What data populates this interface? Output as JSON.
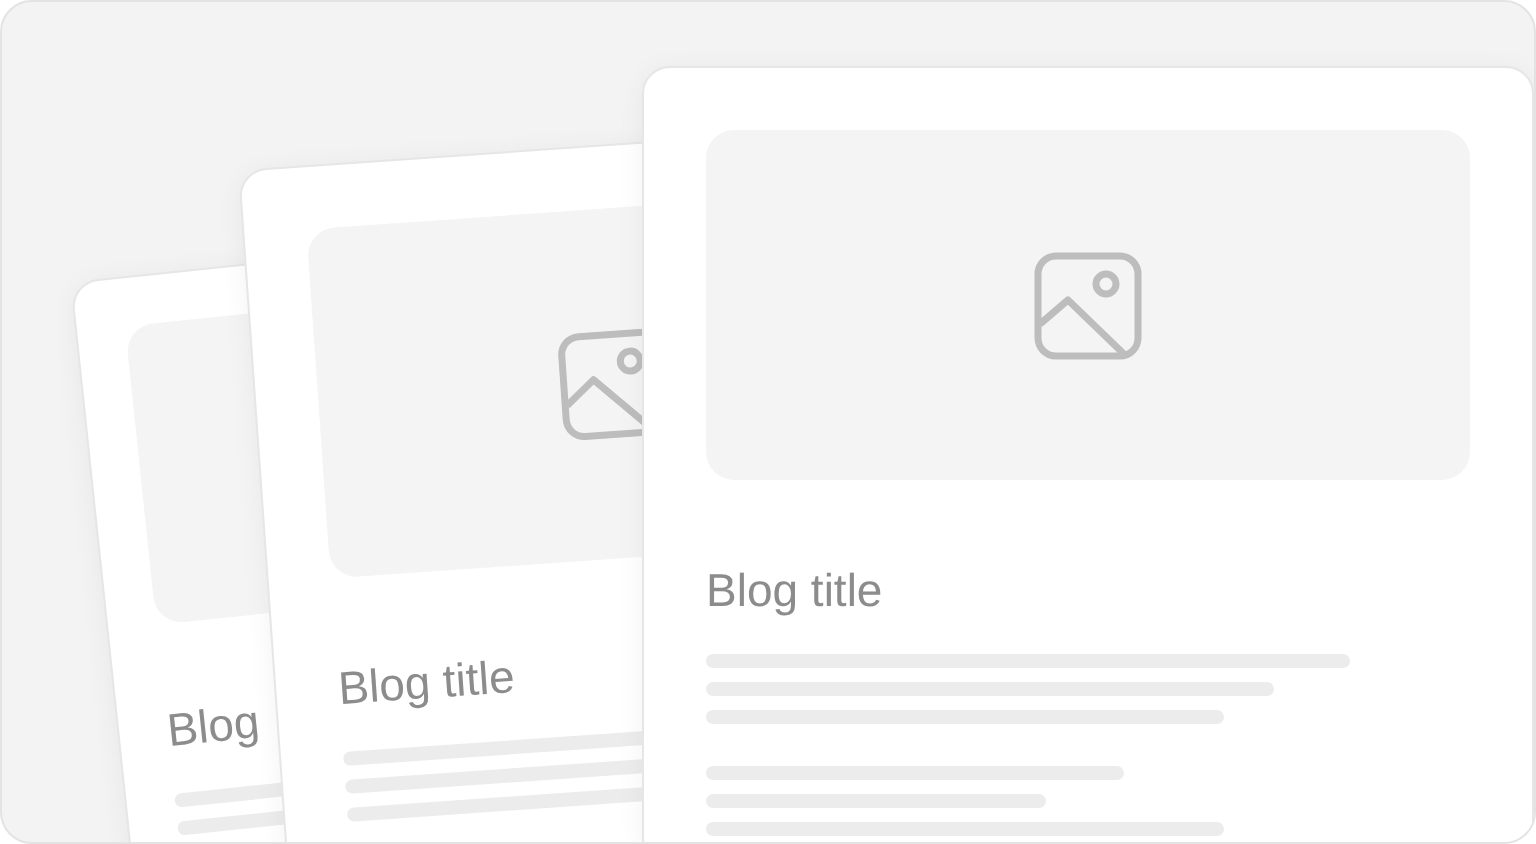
{
  "cards": [
    {
      "title": "Blog"
    },
    {
      "title": "Blog title"
    },
    {
      "title": "Blog title"
    }
  ]
}
